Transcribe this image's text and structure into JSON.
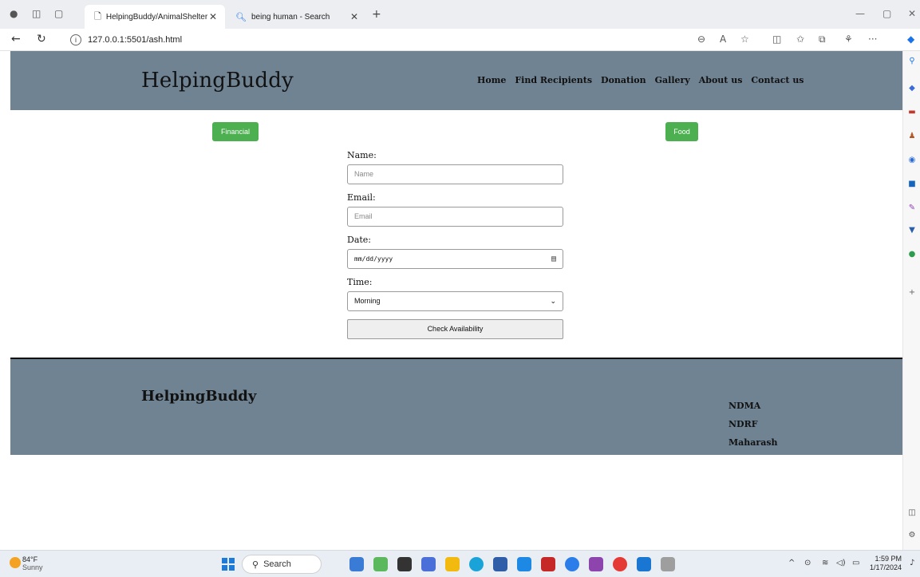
{
  "browser": {
    "tabs": [
      {
        "title": "HelpingBuddy/AnimalShelter",
        "active": true
      },
      {
        "title": "being human - Search",
        "active": false
      }
    ],
    "url": "127.0.0.1:5501/ash.html"
  },
  "header": {
    "brand": "HelpingBuddy",
    "nav": [
      "Home",
      "Find Recipients",
      "Donation",
      "Gallery",
      "About us",
      "Contact us"
    ]
  },
  "tabs": {
    "financial": "Financial",
    "food": "Food"
  },
  "form": {
    "name_label": "Name:",
    "name_placeholder": "Name",
    "email_label": "Email:",
    "email_placeholder": "Email",
    "date_label": "Date:",
    "date_value": "mm/dd/yyyy",
    "time_label": "Time:",
    "time_selected": "Morning",
    "submit_label": "Check Availability"
  },
  "footer": {
    "brand": "HelpingBuddy",
    "links": [
      "NDMA",
      "NDRF",
      "Maharash"
    ]
  },
  "taskbar": {
    "weather_temp": "84°F",
    "weather_desc": "Sunny",
    "search_label": "Search",
    "time": "1:59 PM",
    "date": "1/17/2024"
  },
  "colors": {
    "header_bg": "#708393",
    "button_green": "#4caf50"
  }
}
